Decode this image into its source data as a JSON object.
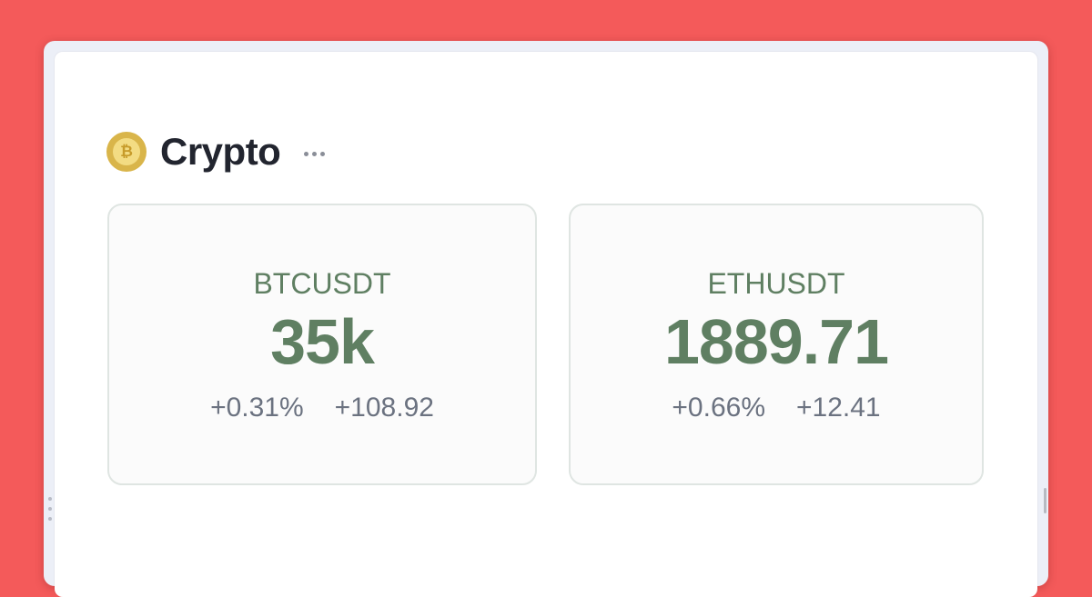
{
  "widget": {
    "title": "Crypto",
    "icon": "bitcoin-coin-icon",
    "icon_glyph": "₿",
    "menu_icon": "more-horizontal-icon"
  },
  "tickers": [
    {
      "symbol": "BTCUSDT",
      "price": "35k",
      "change_percent": "+0.31%",
      "change_value": "+108.92"
    },
    {
      "symbol": "ETHUSDT",
      "price": "1889.71",
      "change_percent": "+0.66%",
      "change_value": "+12.41"
    }
  ],
  "colors": {
    "background": "#f45a5a",
    "accent_green": "#5f7f62",
    "muted_text": "#6b7280",
    "coin_gold": "#d9b54a"
  }
}
